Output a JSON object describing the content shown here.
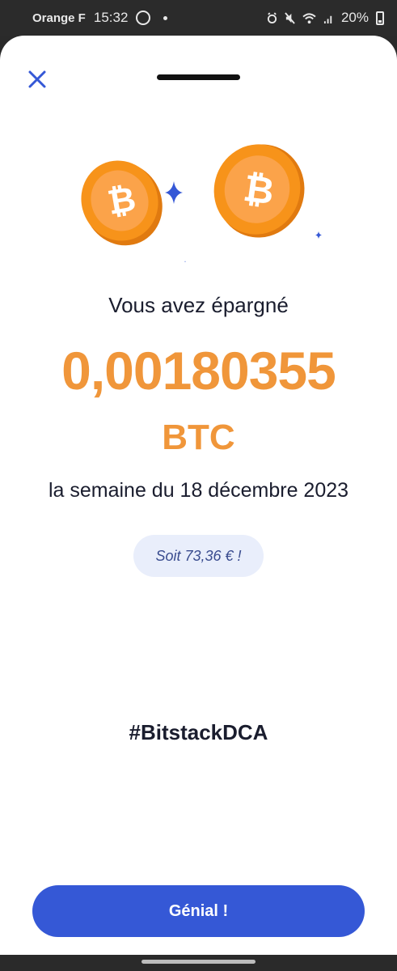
{
  "status_bar": {
    "carrier": "Orange F",
    "time": "15:32",
    "battery": "20%"
  },
  "sheet": {
    "heading": "Vous avez épargné",
    "amount": "0,00180355",
    "unit": "BTC",
    "period": "la semaine du 18 décembre 2023",
    "fiat_pill": "Soit 73,36 € !",
    "hashtag": "#BitstackDCA",
    "cta_label": "Génial !"
  },
  "icons": [
    "close-icon",
    "bitcoin-coin-icon",
    "sparkle-icon",
    "whatsapp-icon",
    "battery-icon",
    "wifi-icon",
    "mute-icon",
    "alarm-icon",
    "signal-icon"
  ],
  "colors": {
    "accent_orange": "#f0963a",
    "primary_blue": "#3558d6",
    "pill_bg": "#e9eefb",
    "text_dark": "#1a1d2e"
  }
}
